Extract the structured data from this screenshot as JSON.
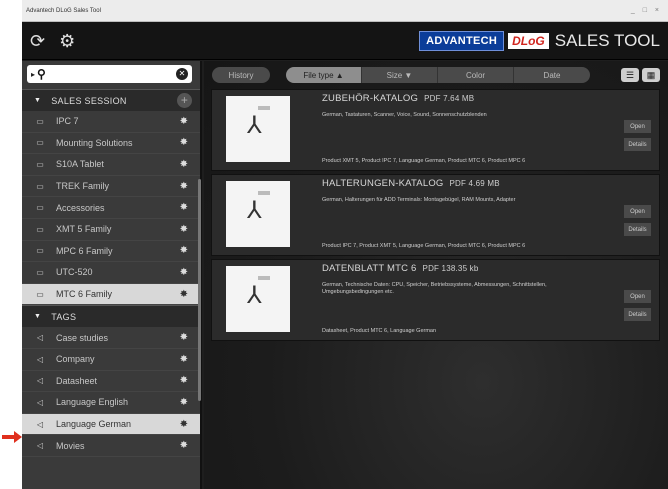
{
  "app": {
    "window_title": "Advantech DLoG Sales Tool",
    "window_controls": "_ □ ×"
  },
  "brand": {
    "logo1": "ADVANTECH",
    "logo2": "DLoG",
    "product": "SALES TOOL"
  },
  "search": {
    "value": "",
    "placeholder": ""
  },
  "sections": {
    "sales_session": "SALES SESSION",
    "tags": "TAGS"
  },
  "session_items": [
    {
      "label": "IPC 7"
    },
    {
      "label": "Mounting Solutions"
    },
    {
      "label": "S10A Tablet"
    },
    {
      "label": "TREK Family"
    },
    {
      "label": "Accessories"
    },
    {
      "label": "XMT 5 Family"
    },
    {
      "label": "MPC 6 Family"
    },
    {
      "label": "UTC-520"
    },
    {
      "label": "MTC 6 Family",
      "selected": true
    }
  ],
  "tag_items": [
    {
      "label": "Case studies"
    },
    {
      "label": "Company"
    },
    {
      "label": "Datasheet"
    },
    {
      "label": "Language English"
    },
    {
      "label": "Language German",
      "selected": true
    },
    {
      "label": "Movies"
    }
  ],
  "toolbar": {
    "history": "History",
    "filetype": "File type ▲",
    "size": "Size ▼",
    "color": "Color",
    "date": "Date"
  },
  "documents": [
    {
      "title": "ZUBEHÖR-KATALOG",
      "meta": "PDF   7.64 MB",
      "description": "German, Tastaturen, Scanner, Voice, Sound, Sonnenschutzblenden",
      "tags": "Product XMT 5, Product IPC 7, Language German, Product MTC 6, Product MPC 6",
      "open": "Open",
      "details": "Details"
    },
    {
      "title": "HALTERUNGEN-KATALOG",
      "meta": "PDF   4.69 MB",
      "description": "German, Halterungen für ADD Terminals: Montagebügel, RAM Mounts, Adapter",
      "tags": "Product IPC 7, Product XMT 5, Language German, Product MTC 6, Product MPC 6",
      "open": "Open",
      "details": "Details"
    },
    {
      "title": "DATENBLATT MTC 6",
      "meta": "PDF   138.35 kb",
      "description": "German, Technische Daten: CPU, Speicher, Betriebssysteme, Abmessungen, Schnittstellen, Umgebungsbedingungen etc.",
      "tags": "Datasheet, Product MTC 6, Language German",
      "open": "Open",
      "details": "Details"
    }
  ],
  "colors": {
    "accent_red": "#e0301e",
    "brand_blue": "#0b3d99"
  }
}
